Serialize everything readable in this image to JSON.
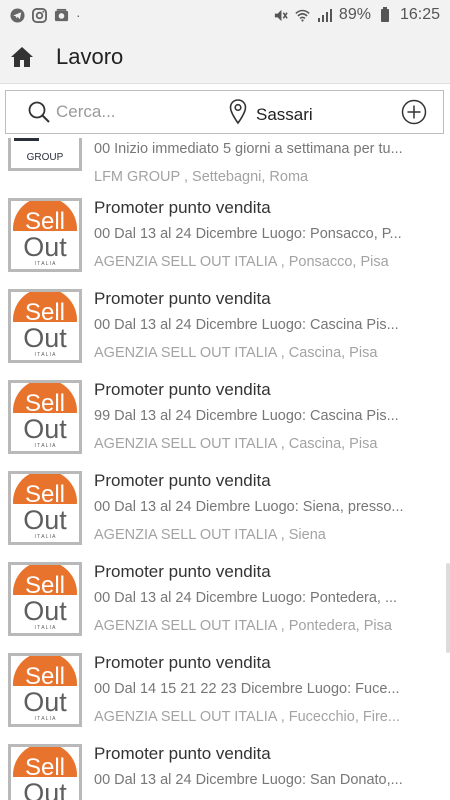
{
  "status_bar": {
    "icons_left": [
      "telegram-icon",
      "instagram-icon",
      "gallery-icon"
    ],
    "dot": "·",
    "icons_right": [
      "mute-icon",
      "wifi-icon",
      "signal-icon",
      "battery-icon"
    ],
    "battery": "89%",
    "time": "16:25"
  },
  "app_bar": {
    "title": "Lavoro"
  },
  "search": {
    "placeholder": "Cerca...",
    "location": "Sassari"
  },
  "jobs": [
    {
      "title": "",
      "description": "00 Inizio immediato 5 giorni a settimana per tu...",
      "meta": "LFM GROUP , Settebagni, Roma",
      "logo": "LFM GROUP"
    },
    {
      "title": "Promoter punto vendita",
      "description": "00 Dal 13 al 24 Dicembre Luogo: Ponsacco, P...",
      "meta": "AGENZIA SELL OUT ITALIA , Ponsacco, Pisa",
      "logo": "Sell Out"
    },
    {
      "title": "Promoter punto vendita",
      "description": "00 Dal 13 al 24 Dicembre Luogo: Cascina Pis...",
      "meta": "AGENZIA SELL OUT ITALIA , Cascina, Pisa",
      "logo": "Sell Out"
    },
    {
      "title": "Promoter punto vendita",
      "description": "99 Dal 13 al 24 Dicembre Luogo: Cascina Pis...",
      "meta": "AGENZIA SELL OUT ITALIA , Cascina, Pisa",
      "logo": "Sell Out"
    },
    {
      "title": "Promoter punto vendita",
      "description": "00 Dal 13 al 24 Diembre Luogo: Siena, presso...",
      "meta": "AGENZIA SELL OUT ITALIA , Siena",
      "logo": "Sell Out"
    },
    {
      "title": "Promoter punto vendita",
      "description": "00 Dal 13 al 24 Dicembre Luogo: Pontedera, ...",
      "meta": "AGENZIA SELL OUT ITALIA , Pontedera, Pisa",
      "logo": "Sell Out"
    },
    {
      "title": "Promoter punto vendita",
      "description": "00 Dal 14 15 21 22 23  Dicembre Luogo: Fuce...",
      "meta": "AGENZIA SELL OUT ITALIA , Fucecchio, Fire...",
      "logo": "Sell Out"
    },
    {
      "title": "Promoter punto vendita",
      "description": "00 Dal 13 al 24 Dicembre Luogo: San Donato,...",
      "meta": "",
      "logo": "Sell Out"
    }
  ],
  "colors": {
    "sellout_orange": "#e8732c",
    "sellout_gray": "#5e5e5e",
    "background": "#ffffff",
    "bar": "#f2f2f2"
  }
}
